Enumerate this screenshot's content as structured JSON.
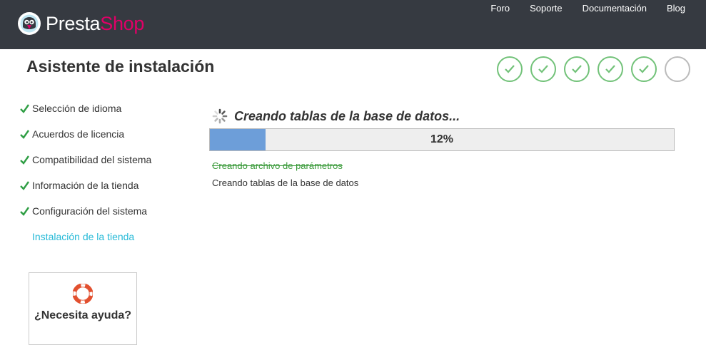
{
  "header": {
    "logo_text_1": "Presta",
    "logo_text_2": "Shop",
    "nav": [
      "Foro",
      "Soporte",
      "Documentación",
      "Blog"
    ]
  },
  "page": {
    "title": "Asistente de instalación"
  },
  "steps": {
    "completed": 5,
    "total": 6
  },
  "sidebar": {
    "items": [
      {
        "label": "Selección de idioma",
        "done": true
      },
      {
        "label": "Acuerdos de licencia",
        "done": true
      },
      {
        "label": "Compatibilidad del sistema",
        "done": true
      },
      {
        "label": "Información de la tienda",
        "done": true
      },
      {
        "label": "Configuración del sistema",
        "done": true
      },
      {
        "label": "Instalación de la tienda",
        "done": false
      }
    ],
    "help": "¿Necesita ayuda?"
  },
  "install": {
    "heading": "Creando tablas de la base de datos...",
    "progress": 0.12,
    "progress_label": "12%",
    "log_done": "Creando archivo de parámetros",
    "log_active": "Creando tablas de la base de datos"
  },
  "colors": {
    "header_bg": "#363a41",
    "brand_pink": "#df0067",
    "check_green": "#72c279",
    "link_blue": "#25b9d7",
    "progress_fill": "#6d9ed9"
  }
}
